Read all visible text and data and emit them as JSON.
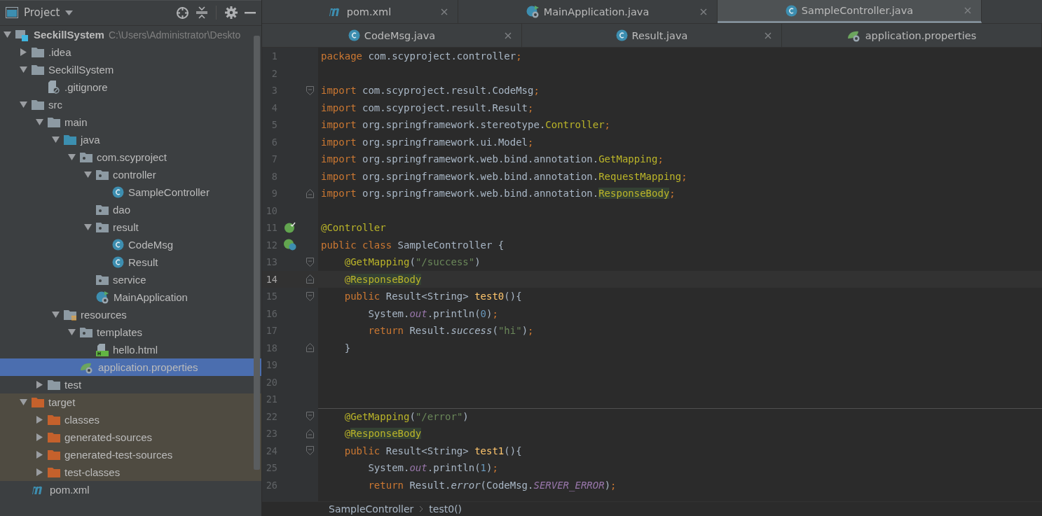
{
  "project_panel": {
    "title": "Project",
    "tree": [
      {
        "name": "SeckillSystem",
        "path": "C:\\Users\\Administrator\\Deskto",
        "kind": "module",
        "expanded": true,
        "selected": false,
        "excluded": false,
        "children": [
          {
            "name": ".idea",
            "kind": "folder",
            "expanded": false,
            "selected": false,
            "excluded": false
          },
          {
            "name": "SeckillSystem",
            "kind": "folder",
            "expanded": true,
            "selected": false,
            "excluded": false,
            "children": [
              {
                "name": ".gitignore",
                "kind": "ignorefile",
                "selected": false,
                "excluded": false
              }
            ]
          },
          {
            "name": "src",
            "kind": "folder",
            "expanded": true,
            "selected": false,
            "excluded": false,
            "children": [
              {
                "name": "main",
                "kind": "folder",
                "expanded": true,
                "selected": false,
                "excluded": false,
                "children": [
                  {
                    "name": "java",
                    "kind": "sourcefolder",
                    "expanded": true,
                    "selected": false,
                    "excluded": false,
                    "children": [
                      {
                        "name": "com.scyproject",
                        "kind": "package",
                        "expanded": true,
                        "selected": false,
                        "excluded": false,
                        "children": [
                          {
                            "name": "controller",
                            "kind": "package",
                            "expanded": true,
                            "selected": false,
                            "excluded": false,
                            "children": [
                              {
                                "name": "SampleController",
                                "kind": "class",
                                "selected": false,
                                "excluded": false
                              }
                            ]
                          },
                          {
                            "name": "dao",
                            "kind": "package",
                            "selected": false,
                            "excluded": false
                          },
                          {
                            "name": "result",
                            "kind": "package",
                            "expanded": true,
                            "selected": false,
                            "excluded": false,
                            "children": [
                              {
                                "name": "CodeMsg",
                                "kind": "class",
                                "selected": false,
                                "excluded": false
                              },
                              {
                                "name": "Result",
                                "kind": "class",
                                "selected": false,
                                "excluded": false
                              }
                            ]
                          },
                          {
                            "name": "service",
                            "kind": "package",
                            "selected": false,
                            "excluded": false
                          },
                          {
                            "name": "MainApplication",
                            "kind": "springclass",
                            "selected": false,
                            "excluded": false
                          }
                        ]
                      }
                    ]
                  },
                  {
                    "name": "resources",
                    "kind": "resources",
                    "expanded": true,
                    "selected": false,
                    "excluded": false,
                    "children": [
                      {
                        "name": "templates",
                        "kind": "package",
                        "expanded": true,
                        "selected": false,
                        "excluded": false,
                        "children": [
                          {
                            "name": "hello.html",
                            "kind": "html",
                            "selected": false,
                            "excluded": false
                          }
                        ]
                      },
                      {
                        "name": "application.properties",
                        "kind": "properties",
                        "selected": true,
                        "excluded": false
                      }
                    ]
                  }
                ]
              },
              {
                "name": "test",
                "kind": "folder",
                "expanded": false,
                "selected": false,
                "excluded": false
              }
            ]
          },
          {
            "name": "target",
            "kind": "folder",
            "expanded": true,
            "selected": false,
            "excluded": true,
            "children": [
              {
                "name": "classes",
                "kind": "folder",
                "expanded": false,
                "selected": false,
                "excluded": true
              },
              {
                "name": "generated-sources",
                "kind": "folder",
                "expanded": false,
                "selected": false,
                "excluded": true
              },
              {
                "name": "generated-test-sources",
                "kind": "folder",
                "expanded": false,
                "selected": false,
                "excluded": true
              },
              {
                "name": "test-classes",
                "kind": "folder",
                "expanded": false,
                "selected": false,
                "excluded": true
              }
            ]
          },
          {
            "name": "pom.xml",
            "kind": "maven",
            "selected": false,
            "excluded": false
          }
        ]
      }
    ]
  },
  "editor_tabs": [
    [
      {
        "label": "pom.xml",
        "kind": "maven",
        "selected": false,
        "closable": true
      },
      {
        "label": "MainApplication.java",
        "kind": "springclass",
        "selected": false,
        "closable": true
      },
      {
        "label": "SampleController.java",
        "kind": "class",
        "selected": true,
        "closable": true
      }
    ],
    [
      {
        "label": "CodeMsg.java",
        "kind": "class",
        "selected": false,
        "closable": true
      },
      {
        "label": "Result.java",
        "kind": "class",
        "selected": false,
        "closable": true
      },
      {
        "label": "application.properties",
        "kind": "properties",
        "selected": false,
        "closable": false
      }
    ]
  ],
  "code_lines": [
    {
      "number": "1",
      "current": false,
      "tokens": [
        {
          "kind": "kw",
          "t": "package "
        },
        {
          "kind": "plain",
          "t": "com.scyproject.controller"
        },
        {
          "kind": "kw",
          "t": ";"
        }
      ]
    },
    {
      "number": "2",
      "current": false
    },
    {
      "number": "3",
      "current": false,
      "fold_start": true,
      "tokens": [
        {
          "kind": "kw",
          "t": "import "
        },
        {
          "kind": "plain",
          "t": "com.scyproject.result.CodeMsg"
        },
        {
          "kind": "kw",
          "t": ";"
        }
      ]
    },
    {
      "number": "4",
      "current": false,
      "tokens": [
        {
          "kind": "kw",
          "t": "import "
        },
        {
          "kind": "plain",
          "t": "com.scyproject.result.Result"
        },
        {
          "kind": "kw",
          "t": ";"
        }
      ]
    },
    {
      "number": "5",
      "current": false,
      "tokens": [
        {
          "kind": "kw",
          "t": "import "
        },
        {
          "kind": "plain",
          "t": "org.springframework.stereotype."
        },
        {
          "kind": "ann",
          "t": "Controller"
        },
        {
          "kind": "kw",
          "t": ";"
        }
      ]
    },
    {
      "number": "6",
      "current": false,
      "tokens": [
        {
          "kind": "kw",
          "t": "import "
        },
        {
          "kind": "plain",
          "t": "org.springframework.ui.Model"
        },
        {
          "kind": "kw",
          "t": ";"
        }
      ]
    },
    {
      "number": "7",
      "current": false,
      "tokens": [
        {
          "kind": "kw",
          "t": "import "
        },
        {
          "kind": "plain",
          "t": "org.springframework.web.bind.annotation."
        },
        {
          "kind": "ann",
          "t": "GetMapping"
        },
        {
          "kind": "kw",
          "t": ";"
        }
      ]
    },
    {
      "number": "8",
      "current": false,
      "tokens": [
        {
          "kind": "kw",
          "t": "import "
        },
        {
          "kind": "plain",
          "t": "org.springframework.web.bind.annotation."
        },
        {
          "kind": "ann",
          "t": "RequestMapping"
        },
        {
          "kind": "kw",
          "t": ";"
        }
      ]
    },
    {
      "number": "9",
      "current": false,
      "fold_end": true,
      "tokens": [
        {
          "kind": "kw",
          "t": "import "
        },
        {
          "kind": "plain",
          "t": "org.springframework.web.bind.annotation."
        },
        {
          "kind": "annhl",
          "t": "ResponseBody"
        },
        {
          "kind": "kw",
          "t": ";"
        }
      ]
    },
    {
      "number": "10",
      "current": false
    },
    {
      "number": "11",
      "current": false,
      "gutter_icon": {
        "kind": "bean"
      },
      "tokens": [
        {
          "kind": "ann",
          "t": "@Controller"
        }
      ]
    },
    {
      "number": "12",
      "current": false,
      "gutter_icon": {
        "kind": "beanclass"
      },
      "tokens": [
        {
          "kind": "kw",
          "t": "public class "
        },
        {
          "kind": "plain",
          "t": "SampleController {"
        }
      ]
    },
    {
      "number": "13",
      "current": false,
      "fold_start": true,
      "tokens": [
        {
          "kind": "ann",
          "t": "    @GetMapping"
        },
        {
          "kind": "plain",
          "t": "("
        },
        {
          "kind": "str",
          "t": "\"/success\""
        },
        {
          "kind": "plain",
          "t": ")"
        }
      ]
    },
    {
      "number": "14",
      "current": true,
      "fold_end": true,
      "tokens": [
        {
          "kind": "ann",
          "t": "    @"
        },
        {
          "kind": "annhl",
          "t": "ResponseBody"
        }
      ]
    },
    {
      "number": "15",
      "current": false,
      "fold_start": true,
      "tokens": [
        {
          "kind": "kw",
          "t": "    public "
        },
        {
          "kind": "plain",
          "t": "Result<String> "
        },
        {
          "kind": "fn",
          "t": "test0"
        },
        {
          "kind": "plain",
          "t": "(){"
        }
      ]
    },
    {
      "number": "16",
      "current": false,
      "tokens": [
        {
          "kind": "plain",
          "t": "        System."
        },
        {
          "kind": "field",
          "t": "out"
        },
        {
          "kind": "plain",
          "t": ".println("
        },
        {
          "kind": "num",
          "t": "0"
        },
        {
          "kind": "plain",
          "t": ")"
        },
        {
          "kind": "kw",
          "t": ";"
        }
      ]
    },
    {
      "number": "17",
      "current": false,
      "tokens": [
        {
          "kind": "kw",
          "t": "        return "
        },
        {
          "kind": "plain",
          "t": "Result."
        },
        {
          "kind": "static",
          "t": "success"
        },
        {
          "kind": "plain",
          "t": "("
        },
        {
          "kind": "str",
          "t": "\"hi\""
        },
        {
          "kind": "plain",
          "t": ")"
        },
        {
          "kind": "kw",
          "t": ";"
        }
      ]
    },
    {
      "number": "18",
      "current": false,
      "fold_end": true,
      "tokens": [
        {
          "kind": "plain",
          "t": "    }"
        }
      ]
    },
    {
      "number": "19",
      "current": false
    },
    {
      "number": "20",
      "current": false
    },
    {
      "number": "21",
      "current": false
    },
    {
      "number": "22",
      "current": false,
      "fold_start": true,
      "separator": true,
      "tokens": [
        {
          "kind": "ann",
          "t": "    @GetMapping"
        },
        {
          "kind": "plain",
          "t": "("
        },
        {
          "kind": "str",
          "t": "\"/error\""
        },
        {
          "kind": "plain",
          "t": ")"
        }
      ]
    },
    {
      "number": "23",
      "current": false,
      "fold_end": true,
      "tokens": [
        {
          "kind": "ann",
          "t": "    @"
        },
        {
          "kind": "annhl",
          "t": "ResponseBody"
        }
      ]
    },
    {
      "number": "24",
      "current": false,
      "fold_start": true,
      "tokens": [
        {
          "kind": "kw",
          "t": "    public "
        },
        {
          "kind": "plain",
          "t": "Result<String> "
        },
        {
          "kind": "fn",
          "t": "test1"
        },
        {
          "kind": "plain",
          "t": "(){"
        }
      ]
    },
    {
      "number": "25",
      "current": false,
      "tokens": [
        {
          "kind": "plain",
          "t": "        System."
        },
        {
          "kind": "field",
          "t": "out"
        },
        {
          "kind": "plain",
          "t": ".println("
        },
        {
          "kind": "num",
          "t": "1"
        },
        {
          "kind": "plain",
          "t": ")"
        },
        {
          "kind": "kw",
          "t": ";"
        }
      ]
    },
    {
      "number": "26",
      "current": false,
      "tokens": [
        {
          "kind": "kw",
          "t": "        return "
        },
        {
          "kind": "plain",
          "t": "Result."
        },
        {
          "kind": "static",
          "t": "error"
        },
        {
          "kind": "plain",
          "t": "(CodeMsg."
        },
        {
          "kind": "field",
          "t": "SERVER_ERROR"
        },
        {
          "kind": "plain",
          "t": ")"
        },
        {
          "kind": "kw",
          "t": ";"
        }
      ]
    }
  ],
  "breadcrumbs": [
    "SampleController",
    "test0()"
  ]
}
